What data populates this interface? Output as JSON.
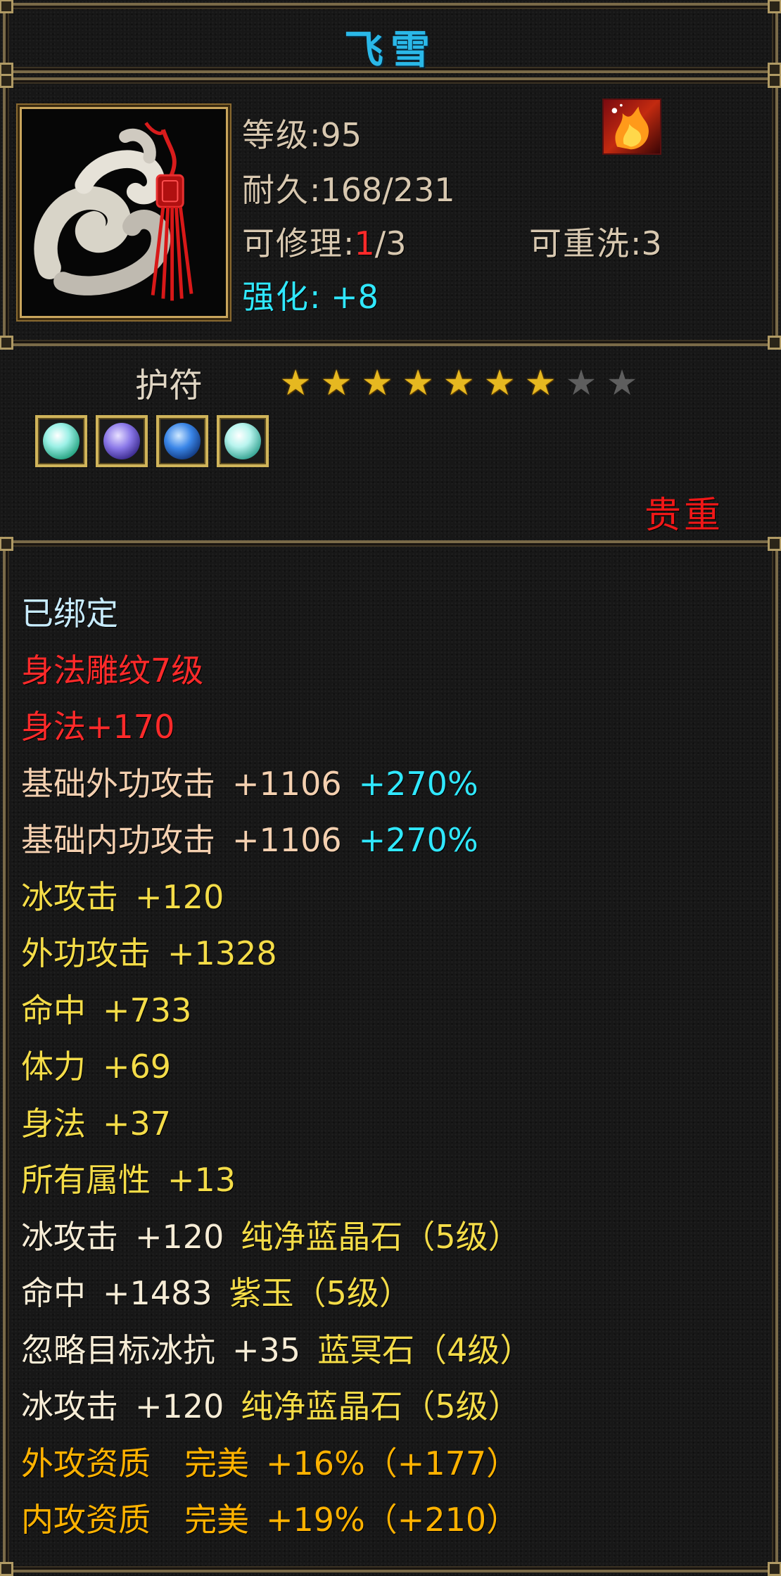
{
  "item": {
    "name": "飞雪",
    "level_label": "等级",
    "level_value": "95",
    "durability_label": "耐久",
    "durability_value": "168/231",
    "repair_label": "可修理",
    "repair_current": "1",
    "repair_max": "/3",
    "rewash_label": "可重洗",
    "rewash_value": "3",
    "enhance_label": "强化",
    "enhance_value": "+8",
    "type": "护符",
    "stars_filled": 7,
    "stars_total": 9,
    "precious": "贵重",
    "gem_icons": [
      "aquamarine-gem-icon",
      "purple-jade-gem-icon",
      "blue-crystal-gem-icon",
      "aquamarine-gem-icon"
    ]
  },
  "attributes": {
    "bound": "已绑定",
    "engrave": "身法雕纹7级",
    "agility_bonus": "身法+170",
    "base_ext_atk": {
      "label": "基础外功攻击",
      "value": "+1106",
      "pct": "+270%"
    },
    "base_int_atk": {
      "label": "基础内功攻击",
      "value": "+1106",
      "pct": "+270%"
    },
    "ice_atk": {
      "label": "冰攻击",
      "value": "+120"
    },
    "ext_atk": {
      "label": "外功攻击",
      "value": "+1328"
    },
    "hit": {
      "label": "命中",
      "value": "+733"
    },
    "stamina": {
      "label": "体力",
      "value": "+69"
    },
    "agility": {
      "label": "身法",
      "value": "+37"
    },
    "all_attr": {
      "label": "所有属性",
      "value": "+13"
    },
    "gem1": {
      "label": "冰攻击",
      "value": "+120",
      "gem": "纯净蓝晶石（5级）"
    },
    "gem2": {
      "label": "命中",
      "value": "+1483",
      "gem": "紫玉（5级）"
    },
    "gem3": {
      "label": "忽略目标冰抗",
      "value": "+35",
      "gem": "蓝冥石（4级）"
    },
    "gem4": {
      "label": "冰攻击",
      "value": "+120",
      "gem": "纯净蓝晶石（5级）"
    },
    "quality1": {
      "label": "外攻资质",
      "grade": "完美",
      "value": "+16%（+177）"
    },
    "quality2": {
      "label": "内攻资质",
      "grade": "完美",
      "value": "+19%（+210）"
    }
  },
  "colors": {
    "title": "#2ab8e8",
    "bound": "#c8ecff",
    "red": "#ff2a2a",
    "cyan": "#30e8ff",
    "yellow": "#f4dc48",
    "orange": "#ffb200",
    "star_on": "#e6b820",
    "star_off": "#5e5e5e"
  }
}
